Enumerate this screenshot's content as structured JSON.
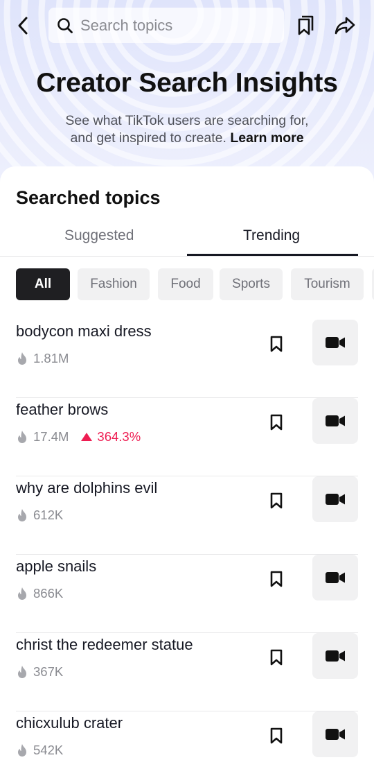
{
  "header": {
    "search_placeholder": "Search topics",
    "icons": {
      "back": "chevron-left-icon",
      "search": "search-icon",
      "bookmarks": "bookmark-list-icon",
      "share": "share-arrow-icon"
    }
  },
  "hero": {
    "title": "Creator Search Insights",
    "subtitle_line1": "See what TikTok users are searching for,",
    "subtitle_line2": "and get inspired to create.",
    "learn_more": "Learn more"
  },
  "section": {
    "title": "Searched topics"
  },
  "tabs": [
    {
      "label": "Suggested",
      "active": false
    },
    {
      "label": "Trending",
      "active": true
    }
  ],
  "chips": [
    {
      "label": "All",
      "active": true
    },
    {
      "label": "Fashion",
      "active": false
    },
    {
      "label": "Food",
      "active": false
    },
    {
      "label": "Sports",
      "active": false
    },
    {
      "label": "Tourism",
      "active": false
    }
  ],
  "topics": [
    {
      "title": "bodycon maxi dress",
      "count": "1.81M",
      "growth": null
    },
    {
      "title": "feather brows",
      "count": "17.4M",
      "growth": "364.3%"
    },
    {
      "title": "why are dolphins evil",
      "count": "612K",
      "growth": null
    },
    {
      "title": "apple snails",
      "count": "866K",
      "growth": null
    },
    {
      "title": "christ the redeemer statue",
      "count": "367K",
      "growth": null
    },
    {
      "title": "chicxulub crater",
      "count": "542K",
      "growth": null
    }
  ],
  "colors": {
    "accent_red": "#ee1d52",
    "hero_bg": "#e3e7fc",
    "text": "#161823",
    "muted": "#8a8b91"
  }
}
